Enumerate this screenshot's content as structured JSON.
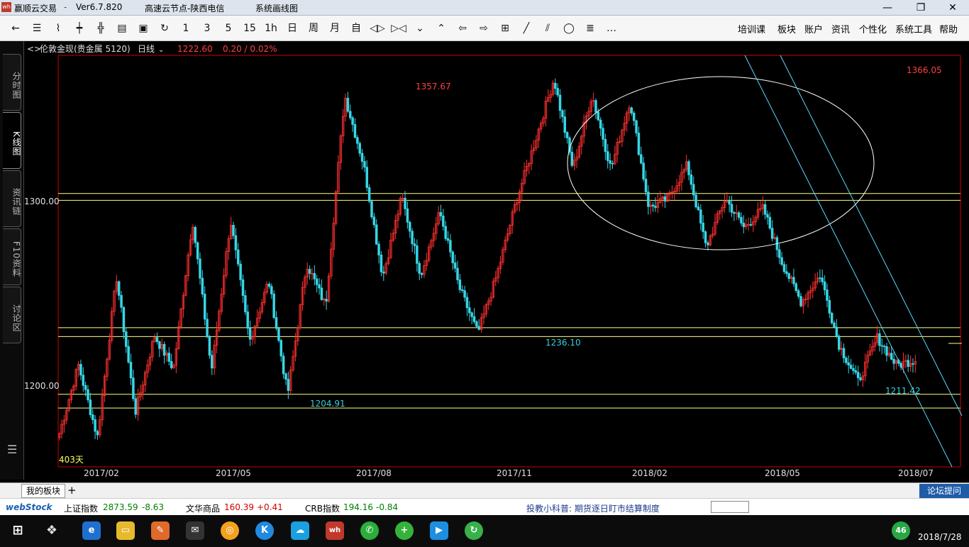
{
  "window": {
    "app_name": "赢顺云交易",
    "version": "Ver6.7.820",
    "server": "高速云节点-陕西电信",
    "extra": "系统画线图",
    "controls": {
      "minimize": "—",
      "restore": "❐",
      "close": "✕"
    }
  },
  "toolbar": {
    "period_buttons": [
      "1",
      "3",
      "5",
      "15",
      "1h",
      "日",
      "周",
      "月",
      "自"
    ],
    "menus": [
      "培训课",
      "板块",
      "账户",
      "资讯",
      "个性化",
      "系统工具",
      "帮助"
    ]
  },
  "side_tabs": [
    "分时图",
    "K线图",
    "资讯链",
    "F10资料",
    "讨论区"
  ],
  "chart_header": {
    "instrument": "伦敦金现(贵金属 5120)",
    "period": "日线",
    "last_price": "1222.60",
    "change": "0.20 / 0.02%",
    "day_count": "403天"
  },
  "colors": {
    "up": "#ff3030",
    "down": "#36d6e6",
    "hline": "#ffff80",
    "ellipse": "#ffffff",
    "price_text_up": "#ff4040",
    "price_text_down": "#38d0e0",
    "axis": "#cc0000"
  },
  "chart_data": {
    "type": "candlestick",
    "instrument": "伦敦金现",
    "ylim": [
      1168,
      1378
    ],
    "y_ticks": [
      "1300.00",
      "1200.00"
    ],
    "x_tick_labels": [
      "2017/02",
      "2017/05",
      "2017/08",
      "2017/11",
      "2018/02",
      "2018/05",
      "2018/07"
    ],
    "anchor_path": [
      1185,
      1220,
      1183,
      1265,
      1196,
      1235,
      1218,
      1294,
      1217,
      1294,
      1232,
      1263,
      1204.91,
      1272,
      1250,
      1357.67,
      1322,
      1265,
      1306,
      1266,
      1298,
      1260,
      1236.1,
      1266,
      1303,
      1334,
      1366.05,
      1320,
      1358,
      1320,
      1355,
      1300,
      1305,
      1322,
      1280,
      1305,
      1290,
      1300,
      1272,
      1252,
      1266,
      1230,
      1211.42,
      1234,
      1220,
      1222.6
    ],
    "annotations": [
      {
        "label": "1357.67",
        "price": 1357.67,
        "kind": "high"
      },
      {
        "label": "1366.05",
        "price": 1366.05,
        "kind": "high"
      },
      {
        "label": "1204.91",
        "price": 1204.91,
        "kind": "low"
      },
      {
        "label": "1236.10",
        "price": 1236.1,
        "kind": "low"
      },
      {
        "label": "1211.42",
        "price": 1211.42,
        "kind": "low"
      }
    ],
    "horizontal_levels": [
      1307.5,
      1304,
      1239,
      1234.5,
      1205,
      1198
    ],
    "drawings": [
      "ellipse",
      "downtrend-channel"
    ]
  },
  "tabs": {
    "my_sector": "我的板块",
    "add": "+",
    "forum": "论坛提问"
  },
  "ticker": {
    "brand": "webStock",
    "items": [
      {
        "name": "上证指数",
        "value": "2873.59",
        "change": "-8.63"
      },
      {
        "name": "文华商品",
        "value": "160.39",
        "change": "+0.41"
      },
      {
        "name": "CRB指数",
        "value": "194.16",
        "change": "-0.84"
      }
    ],
    "news": "投教小科普: 期货逐日盯市结算制度"
  },
  "taskbar": {
    "date": "2018/7/28",
    "badge": "46"
  }
}
